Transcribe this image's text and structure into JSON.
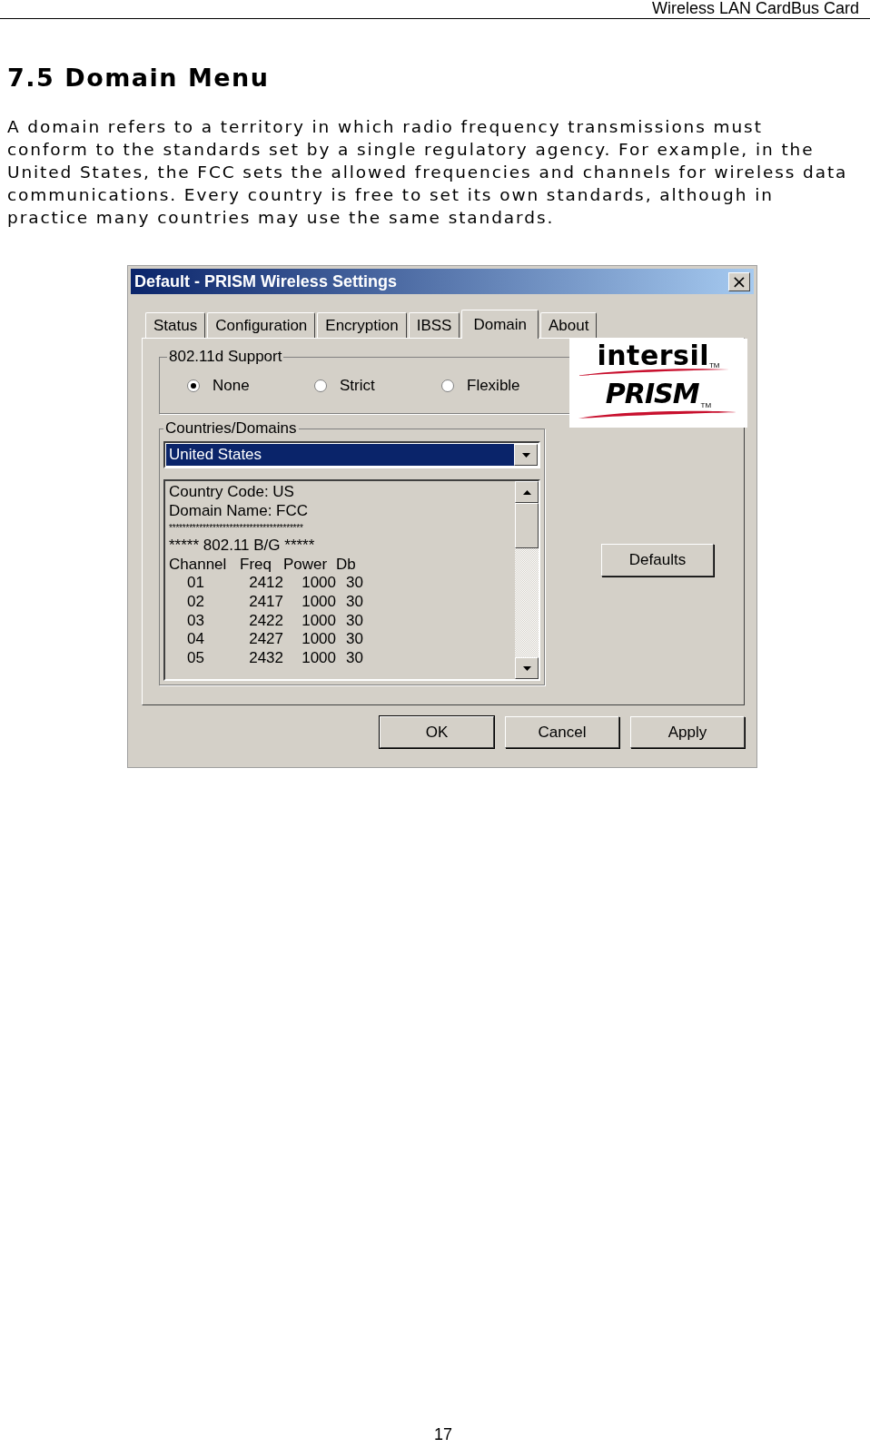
{
  "header": {
    "title": "Wireless LAN CardBus Card"
  },
  "heading": "7.5 Domain Menu",
  "paragraph": "A domain refers to a territory in which radio frequency transmissions must\nconform to the standards set by a single regulatory agency. For example, in the\nUnited States, the FCC sets the allowed frequencies and channels for wireless data\ncommunications. Every country is free to set its own standards, although in\npractice many countries may use the same standards.",
  "dialog": {
    "title": "Default - PRISM Wireless Settings",
    "close": "×",
    "tabs": [
      {
        "label": "Status",
        "selected": false
      },
      {
        "label": "Configuration",
        "selected": false
      },
      {
        "label": "Encryption",
        "selected": false
      },
      {
        "label": "IBSS",
        "selected": false
      },
      {
        "label": "Domain",
        "selected": true
      },
      {
        "label": "About",
        "selected": false
      }
    ],
    "support_group": {
      "label": "802.11d Support",
      "options": [
        {
          "label": "None",
          "selected": true
        },
        {
          "label": "Strict",
          "selected": false
        },
        {
          "label": "Flexible",
          "selected": false
        }
      ]
    },
    "countries_group": {
      "label": "Countries/Domains",
      "dropdown": {
        "value": "United States"
      },
      "info_lines": [
        "Country Code: US",
        "Domain Name: FCC",
        "****************************************",
        "***** 802.11 B/G *****"
      ],
      "columns": [
        "Channel",
        "Freq",
        "Power",
        "Db"
      ],
      "rows": [
        [
          "01",
          "2412",
          "1000",
          "30"
        ],
        [
          "02",
          "2417",
          "1000",
          "30"
        ],
        [
          "03",
          "2422",
          "1000",
          "30"
        ],
        [
          "04",
          "2427",
          "1000",
          "30"
        ],
        [
          "05",
          "2432",
          "1000",
          "30"
        ]
      ]
    },
    "logo": {
      "company": "intersil",
      "product": "PRISM",
      "tm": [
        "TM",
        "TM"
      ]
    },
    "defaults_button": "Defaults",
    "buttons": [
      "OK",
      "Cancel",
      "Apply"
    ]
  },
  "page_number": "17"
}
